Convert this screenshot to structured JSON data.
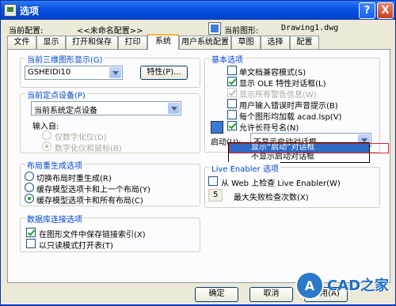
{
  "window": {
    "title": "选项",
    "help_btn": "?",
    "close_btn": "X"
  },
  "profile": {
    "label": "当前配置:",
    "value": "<<未命名配置>>",
    "drawing_label": "当前图形:",
    "drawing_value": "Drawing1.dwg"
  },
  "tabs": [
    {
      "label": "文件"
    },
    {
      "label": "显示"
    },
    {
      "label": "打开和保存"
    },
    {
      "label": "打印"
    },
    {
      "label": "系统",
      "active": true
    },
    {
      "label": "用户系统配置"
    },
    {
      "label": "草图"
    },
    {
      "label": "选择"
    },
    {
      "label": "配置"
    }
  ],
  "graphics3d": {
    "title": "当前三维图形显示(G)",
    "combo_value": "GSHEIDI10",
    "properties_btn": "特性(P)..."
  },
  "pointing": {
    "title": "当前定点设备(P)",
    "combo_value": "当前系统定点设备",
    "accept_label": "输入自:",
    "opt1": "仅数字化仪(D)",
    "opt2": "数字化仪和鼠标(B)"
  },
  "layout_regen": {
    "title": "布局重生成选项",
    "opt1": "切换布局时重生成(R)",
    "opt2": "缓存模型选项卡和上一个布局(Y)",
    "opt3": "缓存模型选项卡和所有布局(C)"
  },
  "dbconnect": {
    "title": "数据库连接选项",
    "opt1": "在图形文件中保存链接索引(X)",
    "opt2": "以只读模式打开表(T)"
  },
  "general": {
    "title": "基本选项",
    "opt1": "单文档兼容模式(S)",
    "opt2": "显示 OLE 特性对话框(L)",
    "opt3": "显示所有警告信息(W)",
    "opt4": "用户输入错误时声音提示(B)",
    "opt5": "每个图形均加载 acad.lsp(V)",
    "opt6": "允许长符号名(N)",
    "startup_label": "启动(U):",
    "startup_value": "不显示启动对话框",
    "dropdown_opt1": "显示“启动”对话框",
    "dropdown_opt2": "不显示启动对话框"
  },
  "live_enabler": {
    "title": "Live Enabler 选项",
    "opt1": "从 Web 上检查 Live Enabler(W)",
    "max_label": "最大失败检查次数(X)",
    "max_value": "5"
  },
  "buttons": {
    "ok": "确定",
    "cancel": "取消",
    "apply": "应用(A)"
  },
  "watermark": "CAD之家"
}
